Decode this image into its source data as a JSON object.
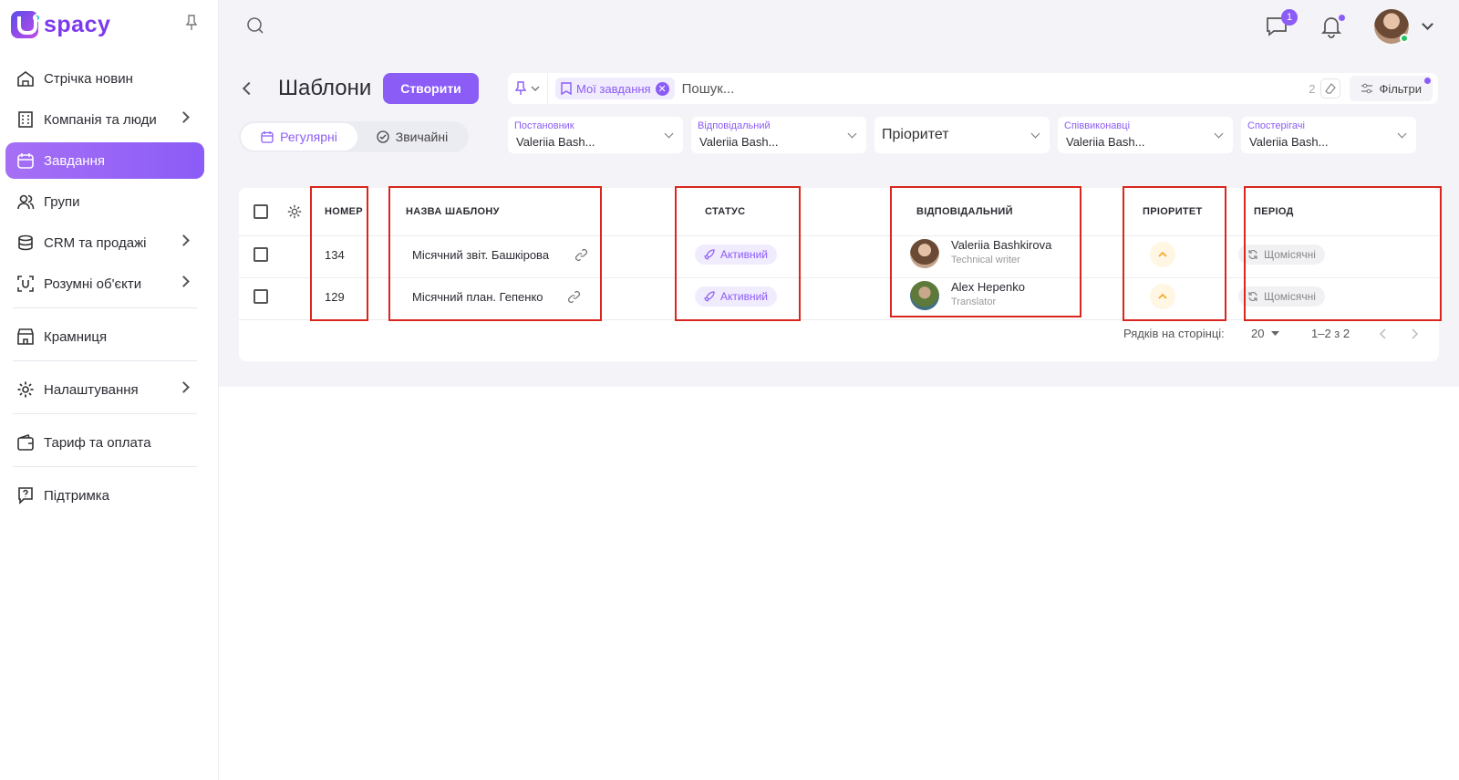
{
  "app": {
    "logo_text": "spacy"
  },
  "sidebar": {
    "items": [
      {
        "label": "Стрічка новин",
        "icon": "home-icon"
      },
      {
        "label": "Компанія та люди",
        "icon": "building-icon",
        "has_children": true
      },
      {
        "label": "Завдання",
        "icon": "calendar-check-icon",
        "active": true
      },
      {
        "label": "Групи",
        "icon": "users-icon"
      },
      {
        "label": "CRM та продажі",
        "icon": "database-icon",
        "has_children": true
      },
      {
        "label": "Розумні об'єкти",
        "icon": "smart-object-icon",
        "has_children": true
      },
      {
        "label": "Крамниця",
        "icon": "store-icon"
      },
      {
        "label": "Налаштування",
        "icon": "gear-icon",
        "has_children": true
      },
      {
        "label": "Тариф та оплата",
        "icon": "wallet-icon"
      },
      {
        "label": "Підтримка",
        "icon": "help-icon"
      }
    ]
  },
  "topbar": {
    "messages_badge": "1"
  },
  "header": {
    "title": "Шаблони",
    "create_label": "Створити"
  },
  "filter_bar": {
    "chip_label": "Мої завдання",
    "search_placeholder": "Пошук...",
    "count": "2",
    "filters_label": "Фільтри"
  },
  "tabs": {
    "regular": "Регулярні",
    "normal": "Звичайні"
  },
  "dropdowns": {
    "author": {
      "label": "Постановник",
      "value": "Valeriia Bash..."
    },
    "responsible": {
      "label": "Відповідальний",
      "value": "Valeriia Bash..."
    },
    "priority": {
      "value": "Пріоритет"
    },
    "coexecutors": {
      "label": "Співвиконавці",
      "value": "Valeriia Bash..."
    },
    "observers": {
      "label": "Спостерігачі",
      "value": "Valeriia Bash..."
    }
  },
  "table": {
    "headers": {
      "number": "НОМЕР",
      "name": "НАЗВА ШАБЛОНУ",
      "status": "СТАТУС",
      "responsible": "ВІДПОВІДАЛЬНИЙ",
      "priority": "ПРІОРИТЕТ",
      "period": "ПЕРІОД"
    },
    "rows": [
      {
        "number": "134",
        "name": "Місячний звіт. Башкірова",
        "status": "Активний",
        "person": "Valeriia Bashkirova",
        "role": "Technical writer",
        "period": "Щомісячні"
      },
      {
        "number": "129",
        "name": "Місячний план. Гепенко",
        "status": "Активний",
        "person": "Alex Hepenko",
        "role": "Translator",
        "period": "Щомісячні"
      }
    ],
    "footer": {
      "rows_label": "Рядків на сторінці:",
      "rows_value": "20",
      "range": "1–2 з 2"
    }
  },
  "colors": {
    "accent": "#8b5cf6",
    "highlight": "#d9271f",
    "priority": "#f5a623"
  }
}
